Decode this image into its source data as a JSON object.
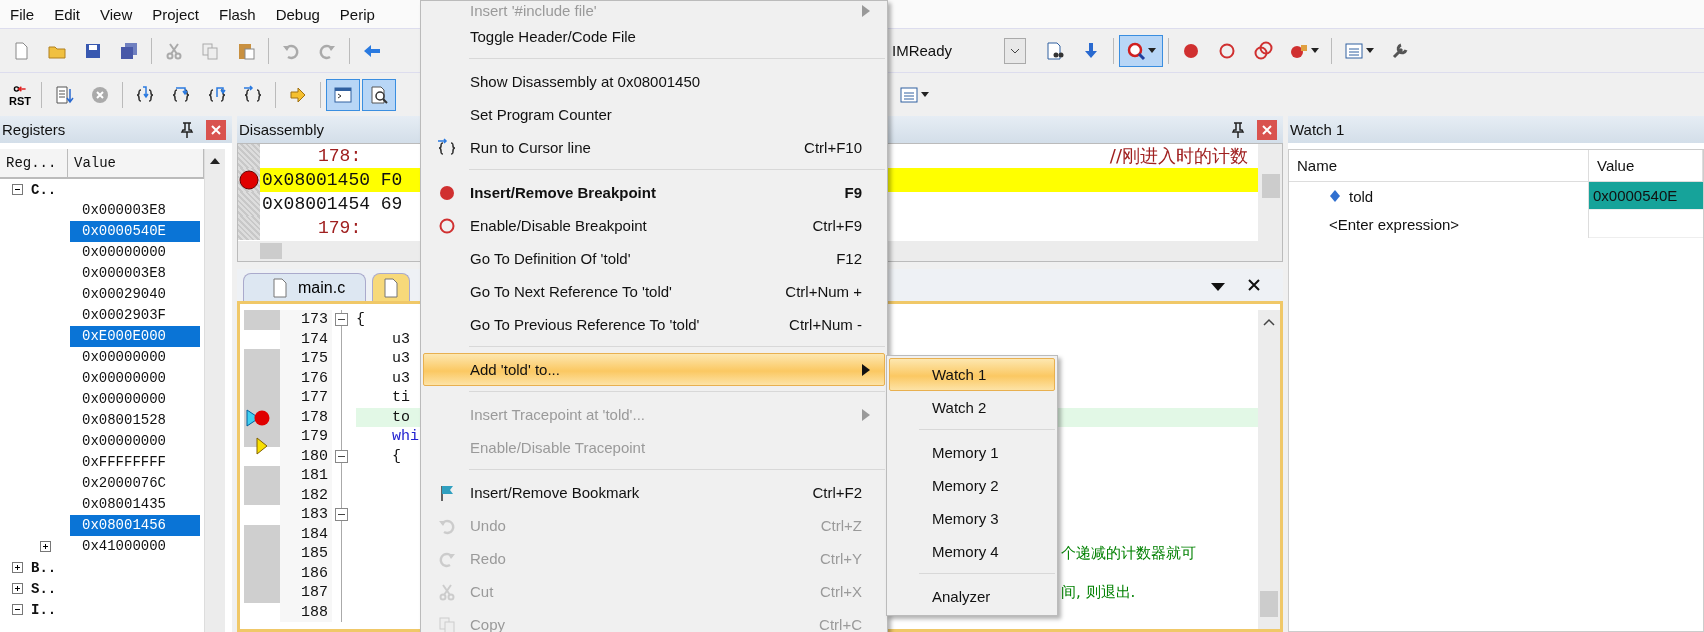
{
  "menu_bar": [
    "File",
    "Edit",
    "View",
    "Project",
    "Flash",
    "Debug",
    "Perip"
  ],
  "toolbar_1": {
    "left_buttons": [
      {
        "selected": false
      },
      {
        "selected": false
      },
      {
        "selected": false
      },
      {
        "selected": false
      },
      {
        "selected": false
      },
      {
        "selected": false
      },
      {
        "selected": false
      },
      {
        "selected": false
      },
      {
        "selected": false
      },
      {
        "selected": false
      }
    ],
    "target": "IMReady",
    "right_buttons": [
      {
        "selected": false
      },
      {
        "selected": false
      },
      {
        "selected": true
      },
      {
        "selected": false
      },
      {
        "selected": false
      },
      {
        "selected": false
      },
      {
        "selected": false
      },
      {
        "selected": false
      },
      {
        "selected": false
      }
    ]
  },
  "toolbar_2": {
    "reset_label": "RST",
    "left_buttons": [
      {
        "selected": false
      },
      {
        "selected": false
      },
      {
        "selected": false
      },
      {
        "selected": false
      },
      {
        "selected": false
      },
      {
        "selected": false
      },
      {
        "selected": false
      },
      {
        "selected": true
      },
      {
        "selected": true
      }
    ],
    "right_buttons": [
      {
        "selected": false
      }
    ]
  },
  "registers": {
    "title": "Registers",
    "columns": [
      "Reg...",
      "Value"
    ],
    "tree": [
      {
        "label": "C..",
        "expanded": true,
        "children": [
          {
            "value": "0x000003E8",
            "selected": false
          },
          {
            "value": "0x0000540E",
            "selected": true
          },
          {
            "value": "0x00000000",
            "selected": false
          },
          {
            "value": "0x000003E8",
            "selected": false
          },
          {
            "value": "0x00029040",
            "selected": false
          },
          {
            "value": "0x0002903F",
            "selected": false
          },
          {
            "value": "0xE000E000",
            "selected": true
          },
          {
            "value": "0x00000000",
            "selected": false
          },
          {
            "value": "0x00000000",
            "selected": false
          },
          {
            "value": "0x00000000",
            "selected": false
          },
          {
            "value": "0x08001528",
            "selected": false
          },
          {
            "value": "0x00000000",
            "selected": false
          },
          {
            "value": "0xFFFFFFFF",
            "selected": false
          },
          {
            "value": "0x2000076C",
            "selected": false
          },
          {
            "value": "0x08001435",
            "selected": false
          },
          {
            "value": "0x08001456",
            "selected": true
          },
          {
            "value": "0x41000000",
            "selected": false,
            "expanded": false
          }
        ]
      },
      {
        "label": "B..",
        "expanded": false
      },
      {
        "label": "S..",
        "expanded": false
      },
      {
        "label": "I..",
        "expanded": true
      }
    ]
  },
  "disassembly": {
    "title": "Disassembly",
    "lines": [
      {
        "text": "178:",
        "kind": "source",
        "comment": "//刚进入时的计数"
      },
      {
        "text": "0x08001450 F0",
        "kind": "instruction",
        "current": true,
        "breakpoint": true
      },
      {
        "text": "0x08001454 69",
        "kind": "instruction",
        "current": false,
        "breakpoint": false
      },
      {
        "text": "179:",
        "kind": "source"
      }
    ]
  },
  "editor": {
    "tabs": [
      {
        "label": "main.c",
        "selected": false
      },
      {
        "selected": true
      }
    ],
    "lines": [
      {
        "number": "173",
        "code": "{",
        "keyword": false,
        "fold": true,
        "executable": true,
        "breakpoint": false,
        "cursor": false,
        "pc": false,
        "highlight": false
      },
      {
        "number": "174",
        "code": "    u3",
        "keyword": false,
        "fold": false,
        "executable": false,
        "breakpoint": false,
        "cursor": false,
        "pc": false,
        "highlight": false
      },
      {
        "number": "175",
        "code": "    u3",
        "keyword": false,
        "fold": false,
        "executable": true,
        "breakpoint": false,
        "cursor": false,
        "pc": false,
        "highlight": false
      },
      {
        "number": "176",
        "code": "    u3",
        "keyword": false,
        "fold": false,
        "executable": true,
        "breakpoint": false,
        "cursor": false,
        "pc": false,
        "highlight": false
      },
      {
        "number": "177",
        "code": "    ti",
        "keyword": false,
        "fold": false,
        "executable": true,
        "breakpoint": false,
        "cursor": false,
        "pc": false,
        "highlight": false
      },
      {
        "number": "178",
        "code": "    to",
        "keyword": false,
        "fold": false,
        "executable": true,
        "breakpoint": true,
        "cursor": true,
        "pc": false,
        "highlight": true
      },
      {
        "number": "179",
        "code": "    whi",
        "keyword": true,
        "fold": false,
        "executable": true,
        "breakpoint": false,
        "cursor": false,
        "pc": true,
        "highlight": false
      },
      {
        "number": "180",
        "code": "    {",
        "keyword": false,
        "fold": true,
        "executable": false,
        "breakpoint": false,
        "cursor": false,
        "pc": false,
        "highlight": false
      },
      {
        "number": "181",
        "fold": false,
        "executable": true,
        "breakpoint": false,
        "cursor": false,
        "pc": false,
        "highlight": false
      },
      {
        "number": "182",
        "fold": false,
        "executable": true,
        "breakpoint": false,
        "cursor": false,
        "pc": false,
        "highlight": false
      },
      {
        "number": "183",
        "fold": true,
        "executable": false,
        "breakpoint": false,
        "cursor": false,
        "pc": false,
        "highlight": false
      },
      {
        "number": "184",
        "fold": false,
        "executable": true,
        "breakpoint": false,
        "cursor": false,
        "pc": false,
        "highlight": false
      },
      {
        "number": "185",
        "comment": "个递减的计数器就可",
        "fold": false,
        "executable": true,
        "breakpoint": false,
        "cursor": false,
        "pc": false,
        "highlight": false
      },
      {
        "number": "186",
        "fold": false,
        "executable": true,
        "breakpoint": false,
        "cursor": false,
        "pc": false,
        "highlight": false
      },
      {
        "number": "187",
        "comment": "间, 则退出.",
        "fold": false,
        "executable": true,
        "breakpoint": false,
        "cursor": false,
        "pc": false,
        "highlight": false
      },
      {
        "number": "188",
        "fold": false,
        "executable": false,
        "breakpoint": false,
        "cursor": false,
        "pc": false,
        "highlight": false
      }
    ]
  },
  "watch": {
    "title": "Watch 1",
    "columns": [
      "Name",
      "Value"
    ],
    "rows": [
      {
        "name": "told",
        "value": "0x0000540E",
        "selected": true
      },
      {
        "name": "<Enter expression>",
        "selected": false
      }
    ]
  },
  "context_menu": {
    "items": [
      {
        "kind": "item",
        "label": "Insert '#include file'",
        "disabled": true,
        "bold": false,
        "submenu": true,
        "selected": false
      },
      {
        "kind": "item",
        "label": "Toggle Header/Code File",
        "disabled": false,
        "bold": false,
        "submenu": false,
        "selected": false
      },
      {
        "kind": "separator"
      },
      {
        "kind": "item",
        "label": "Show Disassembly at 0x08001450",
        "disabled": false,
        "bold": false,
        "submenu": false,
        "selected": false
      },
      {
        "kind": "item",
        "label": "Set Program Counter",
        "disabled": false,
        "bold": false,
        "submenu": false,
        "selected": false
      },
      {
        "kind": "item",
        "label": "Run to Cursor line",
        "shortcut": "Ctrl+F10",
        "disabled": false,
        "bold": false,
        "submenu": false,
        "selected": false
      },
      {
        "kind": "separator"
      },
      {
        "kind": "item",
        "label": "Insert/Remove Breakpoint",
        "shortcut": "F9",
        "disabled": false,
        "bold": true,
        "submenu": false,
        "selected": false
      },
      {
        "kind": "item",
        "label": "Enable/Disable Breakpoint",
        "shortcut": "Ctrl+F9",
        "disabled": false,
        "bold": false,
        "submenu": false,
        "selected": false
      },
      {
        "kind": "item",
        "label": "Go To Definition Of 'told'",
        "shortcut": "F12",
        "disabled": false,
        "bold": false,
        "submenu": false,
        "selected": false
      },
      {
        "kind": "item",
        "label": "Go To Next Reference To 'told'",
        "shortcut": "Ctrl+Num +",
        "disabled": false,
        "bold": false,
        "submenu": false,
        "selected": false
      },
      {
        "kind": "item",
        "label": "Go To Previous Reference To 'told'",
        "shortcut": "Ctrl+Num -",
        "disabled": false,
        "bold": false,
        "submenu": false,
        "selected": false
      },
      {
        "kind": "separator"
      },
      {
        "kind": "item",
        "label": "Add 'told' to...",
        "disabled": false,
        "bold": false,
        "submenu": true,
        "selected": true
      },
      {
        "kind": "separator"
      },
      {
        "kind": "item",
        "label": "Insert Tracepoint at 'told'...",
        "disabled": true,
        "bold": false,
        "submenu": true,
        "selected": false
      },
      {
        "kind": "item",
        "label": "Enable/Disable Tracepoint",
        "disabled": true,
        "bold": false,
        "submenu": false,
        "selected": false
      },
      {
        "kind": "separator"
      },
      {
        "kind": "item",
        "label": "Insert/Remove Bookmark",
        "shortcut": "Ctrl+F2",
        "disabled": false,
        "bold": false,
        "submenu": false,
        "selected": false
      },
      {
        "kind": "item",
        "label": "Undo",
        "shortcut": "Ctrl+Z",
        "disabled": true,
        "bold": false,
        "submenu": false,
        "selected": false
      },
      {
        "kind": "item",
        "label": "Redo",
        "shortcut": "Ctrl+Y",
        "disabled": true,
        "bold": false,
        "submenu": false,
        "selected": false
      },
      {
        "kind": "item",
        "label": "Cut",
        "shortcut": "Ctrl+X",
        "disabled": true,
        "bold": false,
        "submenu": false,
        "selected": false
      },
      {
        "kind": "item",
        "label": "Copy",
        "shortcut": "Ctrl+C",
        "disabled": true,
        "bold": false,
        "submenu": false,
        "selected": false
      }
    ]
  },
  "submenu": {
    "items": [
      {
        "kind": "item",
        "label": "Watch 1",
        "selected": true
      },
      {
        "kind": "item",
        "label": "Watch 2",
        "selected": false
      },
      {
        "kind": "separator"
      },
      {
        "kind": "item",
        "label": "Memory 1",
        "selected": false
      },
      {
        "kind": "item",
        "label": "Memory 2",
        "selected": false
      },
      {
        "kind": "item",
        "label": "Memory 3",
        "selected": false
      },
      {
        "kind": "item",
        "label": "Memory 4",
        "selected": false
      },
      {
        "kind": "separator"
      },
      {
        "kind": "item",
        "label": "Analyzer",
        "selected": false
      }
    ]
  }
}
